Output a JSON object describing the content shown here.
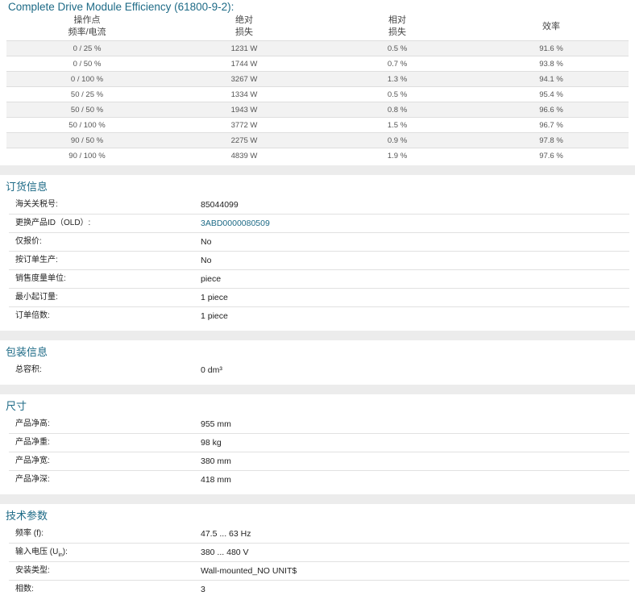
{
  "efficiency": {
    "title": "Complete Drive Module Efficiency (61800-9-2):",
    "headers": [
      [
        "操作点",
        "频率/电流"
      ],
      [
        "绝对",
        "损失"
      ],
      [
        "相对",
        "损失"
      ],
      [
        "效率"
      ]
    ],
    "rows": [
      [
        "0 / 25 %",
        "1231 W",
        "0.5 %",
        "91.6 %"
      ],
      [
        "0 / 50 %",
        "1744 W",
        "0.7 %",
        "93.8 %"
      ],
      [
        "0 / 100 %",
        "3267 W",
        "1.3 %",
        "94.1 %"
      ],
      [
        "50 / 25 %",
        "1334 W",
        "0.5 %",
        "95.4 %"
      ],
      [
        "50 / 50 %",
        "1943 W",
        "0.8 %",
        "96.6 %"
      ],
      [
        "50 / 100 %",
        "3772 W",
        "1.5 %",
        "96.7 %"
      ],
      [
        "90 / 50 %",
        "2275 W",
        "0.9 %",
        "97.8 %"
      ],
      [
        "90 / 100 %",
        "4839 W",
        "1.9 %",
        "97.6 %"
      ]
    ]
  },
  "ordering": {
    "title": "订货信息",
    "rows": [
      {
        "key": "海关关税号:",
        "value": "85044099"
      },
      {
        "key": "更换产品ID（OLD）:",
        "value": "3ABD0000080509"
      },
      {
        "key": "仅报价:",
        "value": "No"
      },
      {
        "key": "按订单生产:",
        "value": "No"
      },
      {
        "key": "销售度量单位:",
        "value": "piece"
      },
      {
        "key": "最小起订量:",
        "value": "1 piece"
      },
      {
        "key": "订单倍数:",
        "value": "1 piece"
      }
    ]
  },
  "packaging": {
    "title": "包装信息",
    "rows": [
      {
        "key": "总容积:",
        "value": "0 dm³"
      }
    ]
  },
  "dimensions": {
    "title": "尺寸",
    "rows": [
      {
        "key": "产品净高:",
        "value": "955 mm"
      },
      {
        "key": "产品净重:",
        "value": "98 kg"
      },
      {
        "key": "产品净宽:",
        "value": "380 mm"
      },
      {
        "key": "产品净深:",
        "value": "418 mm"
      }
    ]
  },
  "technical": {
    "title": "技术参数",
    "freq_key": "频率 (f):",
    "voltage_key_prefix": "输入电压 (U",
    "voltage_key_sub": "in",
    "voltage_key_suffix": "):",
    "rows": [
      {
        "value": "47.5 ... 63 Hz"
      },
      {
        "value": "380 ... 480 V"
      },
      {
        "key": "安装类型:",
        "value": "Wall-mounted_NO UNIT$"
      },
      {
        "key": "相数:",
        "value": "3"
      }
    ]
  }
}
